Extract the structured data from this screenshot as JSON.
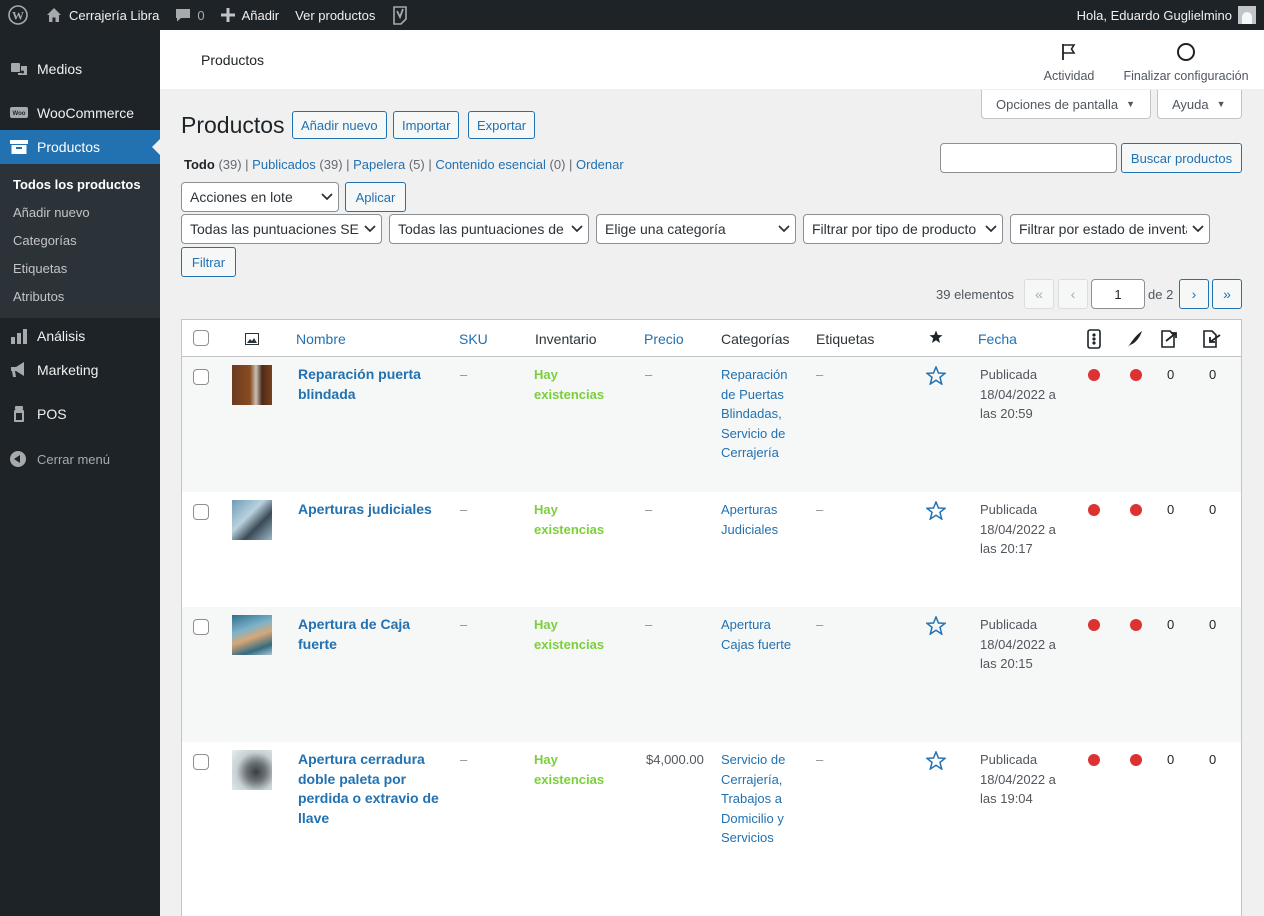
{
  "adminbar": {
    "site_name": "Cerrajería Libra",
    "comments_count": "0",
    "add_new": "Añadir",
    "view_products": "Ver productos",
    "greeting": "Hola, Eduardo Guglielmino"
  },
  "sidebar": {
    "items": [
      {
        "label": "Medios",
        "icon": "media-icon"
      },
      {
        "label": "WooCommerce",
        "icon": "woocommerce-icon"
      },
      {
        "label": "Productos",
        "icon": "archive-icon"
      },
      {
        "label": "Análisis",
        "icon": "bar-chart-icon"
      },
      {
        "label": "Marketing",
        "icon": "megaphone-icon"
      },
      {
        "label": "POS",
        "icon": "pos-icon"
      }
    ],
    "submenu": [
      "Todos los productos",
      "Añadir nuevo",
      "Categorías",
      "Etiquetas",
      "Atributos"
    ],
    "collapse": "Cerrar menú"
  },
  "header": {
    "title": "Productos",
    "activity": "Actividad",
    "finish_setup": "Finalizar configuración"
  },
  "screen_options": "Opciones de pantalla",
  "help": "Ayuda",
  "page": {
    "title": "Productos",
    "add_new": "Añadir nuevo",
    "import": "Importar",
    "export": "Exportar"
  },
  "views": {
    "all": "Todo",
    "all_count": "(39)",
    "published": "Publicados",
    "published_count": "(39)",
    "trash": "Papelera",
    "trash_count": "(5)",
    "cornerstone": "Contenido esencial",
    "cornerstone_count": "(0)",
    "sort": "Ordenar"
  },
  "search": {
    "button": "Buscar productos",
    "value": ""
  },
  "bulk": {
    "select": "Acciones en lote",
    "apply": "Aplicar"
  },
  "filters": {
    "seo": "Todas las puntuaciones SEO",
    "readability": "Todas las puntuaciones de legibilidad",
    "category": "Elige una categoría",
    "type": "Filtrar por tipo de producto",
    "stock": "Filtrar por estado de inventario",
    "button": "Filtrar"
  },
  "pagination": {
    "count": "39 elementos",
    "first": "«",
    "prev": "‹",
    "current": "1",
    "of": "de 2",
    "next": "›",
    "last": "»"
  },
  "table": {
    "headers": {
      "name": "Nombre",
      "sku": "SKU",
      "stock": "Inventario",
      "price": "Precio",
      "categories": "Categorías",
      "tags": "Etiquetas",
      "date": "Fecha"
    },
    "rows": [
      {
        "name": "Reparación puerta blindada",
        "sku": "–",
        "stock": "Hay existencias",
        "price": "–",
        "categories": "Reparación de Puertas Blindadas, Servicio de Cerrajería",
        "tags": "–",
        "status": "Publicada",
        "date": "18/04/2022 a las 20:59",
        "links_out": "0",
        "links_in": "0"
      },
      {
        "name": "Aperturas judiciales",
        "sku": "–",
        "stock": "Hay existencias",
        "price": "–",
        "categories": "Aperturas Judiciales",
        "tags": "–",
        "status": "Publicada",
        "date": "18/04/2022 a las 20:17",
        "links_out": "0",
        "links_in": "0"
      },
      {
        "name": "Apertura de Caja fuerte",
        "sku": "–",
        "stock": "Hay existencias",
        "price": "–",
        "categories": "Apertura Cajas fuerte",
        "tags": "–",
        "status": "Publicada",
        "date": "18/04/2022 a las 20:15",
        "links_out": "0",
        "links_in": "0"
      },
      {
        "name": "Apertura cerradura doble paleta por perdida o extravio de llave",
        "sku": "–",
        "stock": "Hay existencias",
        "price": "$4,000.00",
        "categories": "Servicio de Cerrajería, Trabajos a Domicilio y Servicios",
        "tags": "–",
        "status": "Publicada",
        "date": "18/04/2022 a las 19:04",
        "links_out": "0",
        "links_in": "0"
      }
    ]
  },
  "colors": {
    "accent": "#2271b1",
    "admin_bar": "#1d2327",
    "in_stock": "#7ad03a",
    "seo_bad": "#dc3232"
  }
}
